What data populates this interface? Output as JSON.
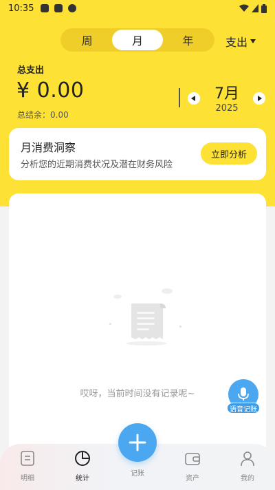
{
  "status_bar": {
    "time": "10:35"
  },
  "period_tabs": [
    {
      "label": "周",
      "active": false
    },
    {
      "label": "月",
      "active": true
    },
    {
      "label": "年",
      "active": false
    }
  ],
  "type_selector": {
    "label": "支出"
  },
  "summary": {
    "total_label": "总支出",
    "amount": "¥ 0.00",
    "balance": "总结余：0.00",
    "month": "7月",
    "year": "2025"
  },
  "insight": {
    "title": "月消费洞察",
    "description": "分析您的近期消费状况及潜在财务风险",
    "button_label": "立即分析"
  },
  "empty_state": {
    "text": "哎呀，当前时间没有记录呢~"
  },
  "voice_button": {
    "label": "语音记账"
  },
  "tabbar": [
    {
      "label": "明细",
      "icon": "doc-list-icon",
      "active": false
    },
    {
      "label": "统计",
      "icon": "pie-chart-icon",
      "active": true
    },
    {
      "label": "记账",
      "icon": "plus-icon",
      "active": false
    },
    {
      "label": "资产",
      "icon": "wallet-icon",
      "active": false
    },
    {
      "label": "我的",
      "icon": "person-icon",
      "active": false
    }
  ],
  "colors": {
    "brand_yellow": "#fde134",
    "accent_blue": "#4aa7f0"
  }
}
